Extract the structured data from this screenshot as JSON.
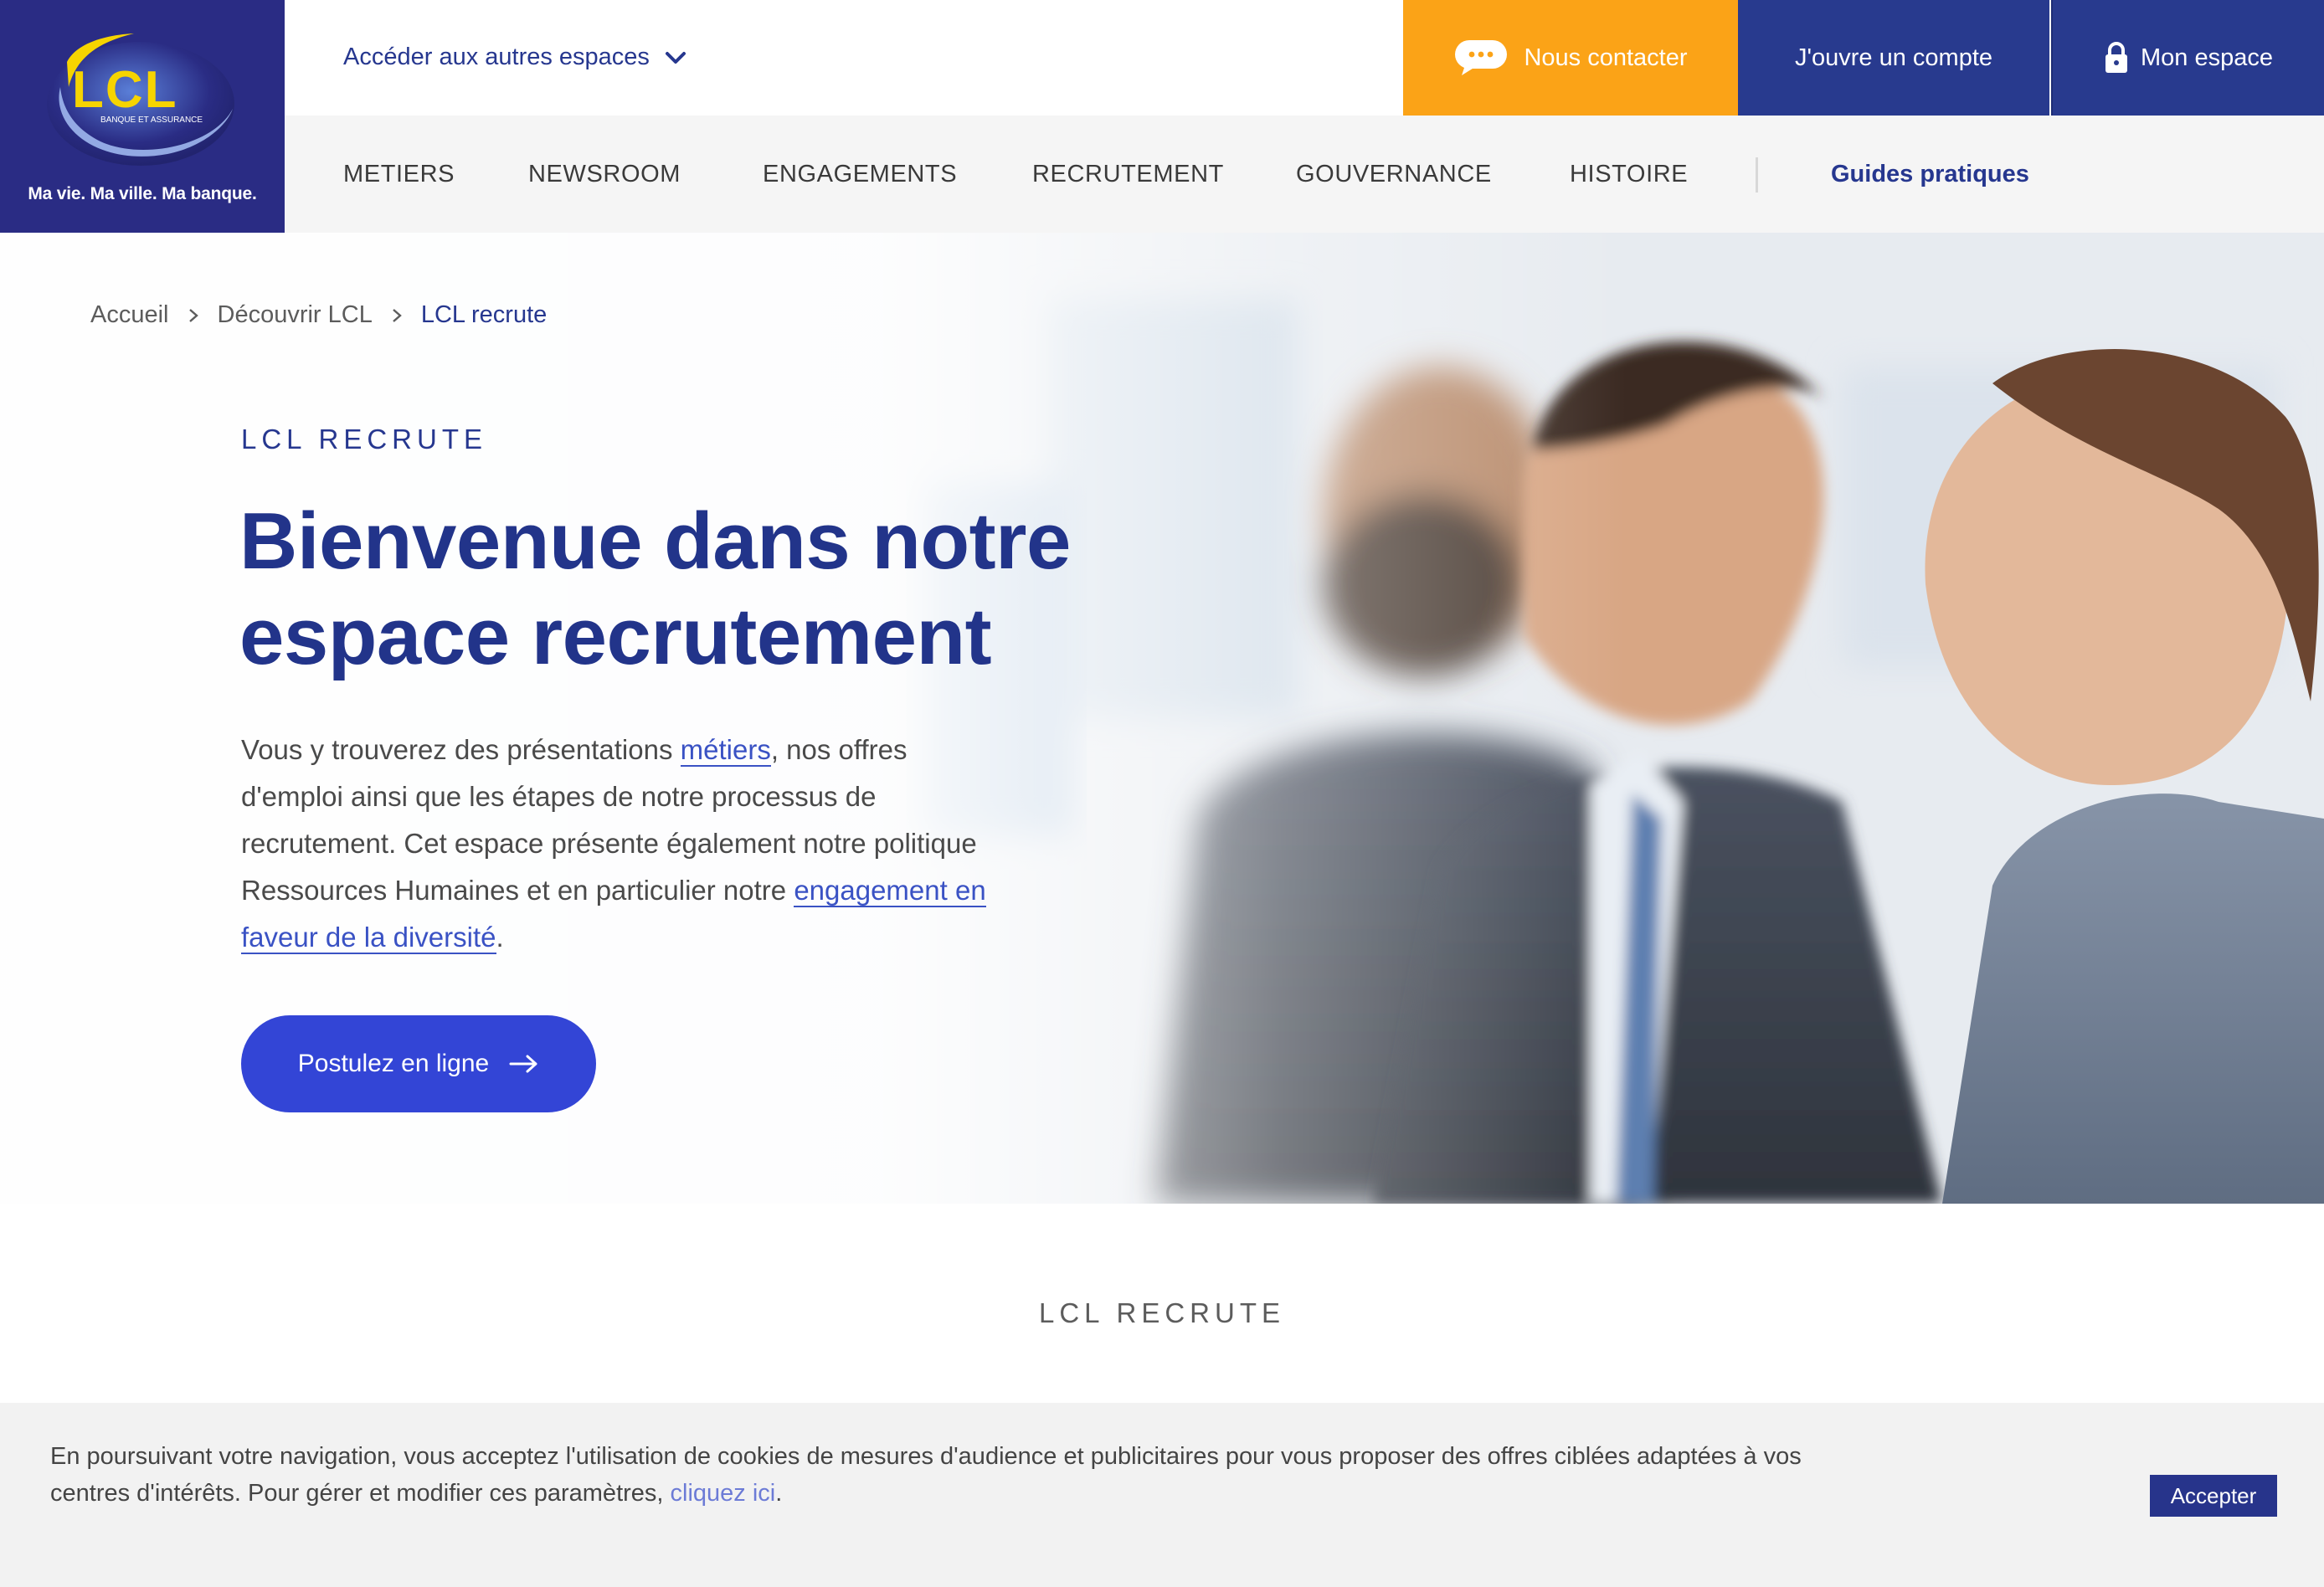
{
  "brand": {
    "logo_text": "LCL",
    "logo_subtext": "BANQUE ET ASSURANCE",
    "tagline": "Ma vie. Ma ville. Ma banque.",
    "colors": {
      "navy": "#2a2c84",
      "blue": "#283a8e",
      "orange": "#fba317",
      "cta": "#3345d6",
      "logo_yellow": "#f6d400"
    }
  },
  "topbar": {
    "spaces_label": "Accéder aux autres espaces",
    "contact_label": "Nous contacter",
    "open_account_label": "J'ouvre un compte",
    "my_space_label": "Mon espace"
  },
  "nav": {
    "items": [
      "METIERS",
      "NEWSROOM",
      "ENGAGEMENTS",
      "RECRUTEMENT",
      "GOUVERNANCE",
      "HISTOIRE"
    ],
    "guides_label": "Guides pratiques"
  },
  "breadcrumb": {
    "items": [
      "Accueil",
      "Découvrir LCL"
    ],
    "current": "LCL recrute"
  },
  "hero": {
    "eyebrow": "LCL RECRUTE",
    "title_line1": "Bienvenue dans notre",
    "title_line2": "espace recrutement",
    "text_part1": "Vous y trouverez des présentations ",
    "link_metiers": "métiers",
    "text_part2": ", nos offres d'emploi ainsi que les étapes de notre processus de recrutement. Cet espace présente également notre politique Ressources Humaines et en particulier notre ",
    "link_diversite": "engagement en faveur de la diversité",
    "text_part3": ".",
    "cta_label": "Postulez en ligne"
  },
  "section": {
    "eyebrow": "LCL RECRUTE"
  },
  "cookie": {
    "text": "En poursuivant votre navigation, vous acceptez l'utilisation de cookies de mesures d'audience et publicitaires pour vous proposer des offres ciblées adaptées à vos centres d'intérêts. Pour gérer et modifier ces paramètres, ",
    "link": "cliquez ici",
    "text_end": ".",
    "accept_label": "Accepter"
  }
}
